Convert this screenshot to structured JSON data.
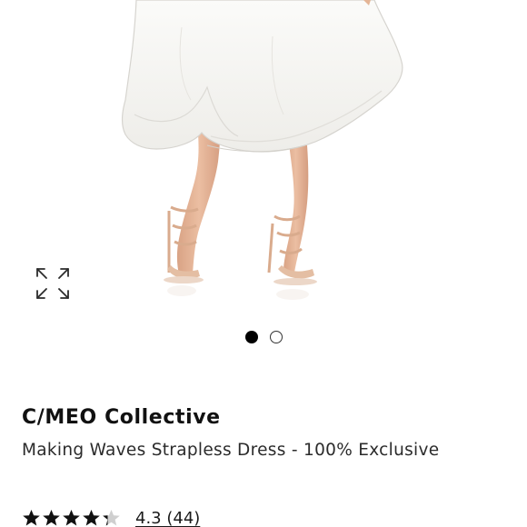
{
  "product": {
    "brand": "C/MEO Collective",
    "name": "Making Waves Strapless Dress - 100% Exclusive"
  },
  "gallery": {
    "image_count": 2,
    "active_index": 0,
    "expand_icon": "expand-arrows-icon"
  },
  "rating": {
    "stars": 4.3,
    "max": 5,
    "label": "4.3 (44)"
  },
  "colors": {
    "dress": "#f6f5f2",
    "skin": "#e2b194",
    "heels": "#e3b89b",
    "dot_active": "#000000"
  }
}
